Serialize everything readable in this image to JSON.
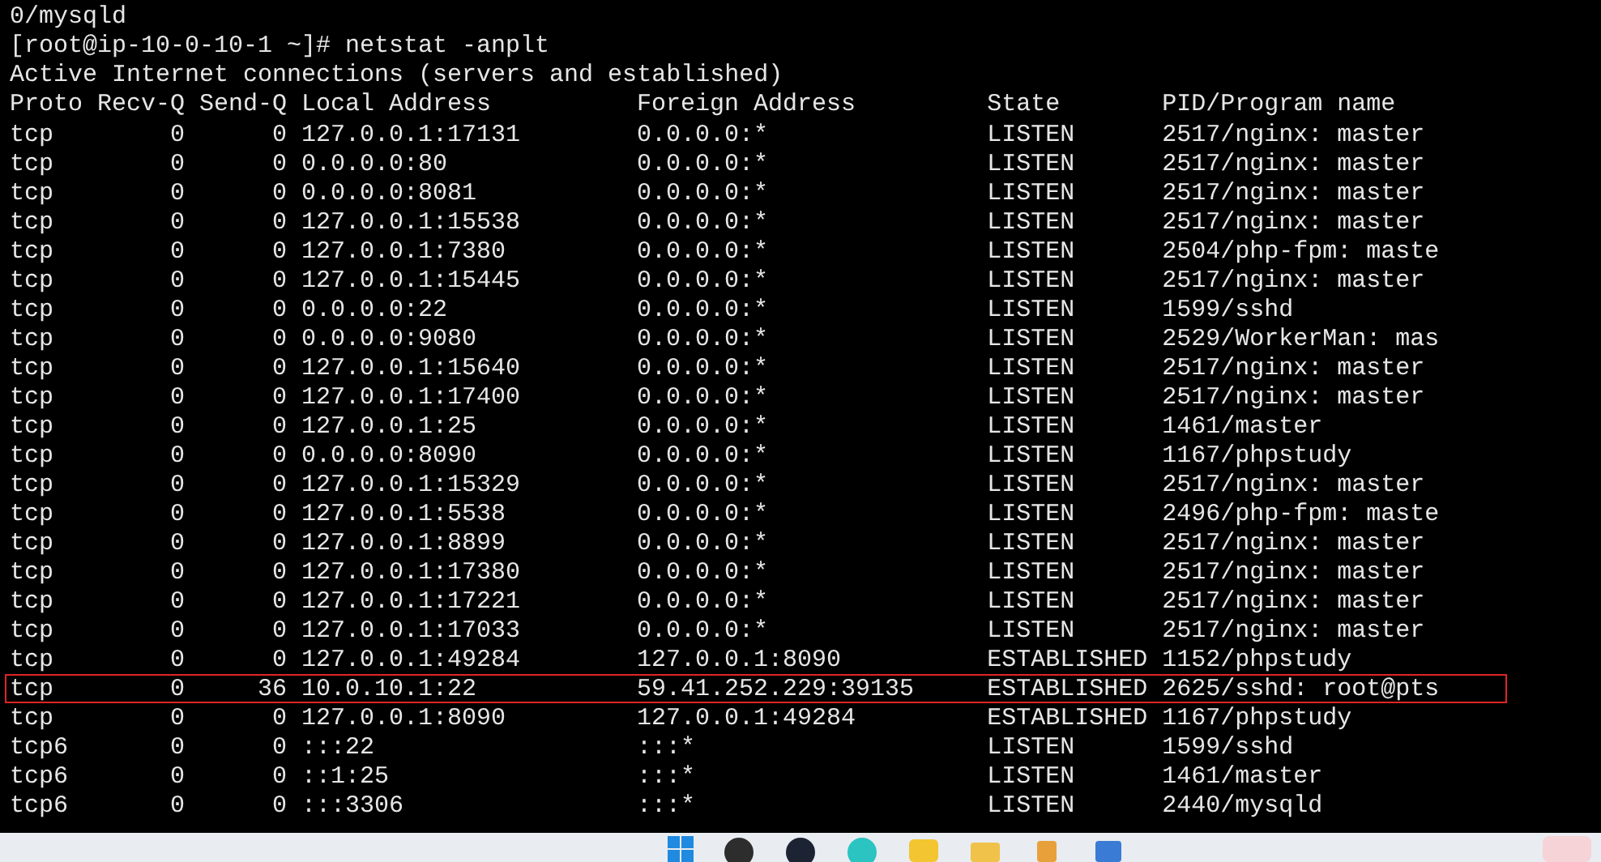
{
  "lines_above": [
    "0/mysqld",
    "[root@ip-10-0-10-1 ~]# netstat -anplt",
    "Active Internet connections (servers and established)"
  ],
  "table": {
    "columns": [
      "Proto",
      "Recv-Q",
      "Send-Q",
      "Local Address",
      "Foreign Address",
      "State",
      "PID/Program name"
    ],
    "rows": [
      {
        "proto": "tcp",
        "recv_q": "0",
        "send_q": "0",
        "local": "127.0.0.1:17131",
        "foreign": "0.0.0.0:*",
        "state": "LISTEN",
        "program": "2517/nginx: master",
        "highlighted": false
      },
      {
        "proto": "tcp",
        "recv_q": "0",
        "send_q": "0",
        "local": "0.0.0.0:80",
        "foreign": "0.0.0.0:*",
        "state": "LISTEN",
        "program": "2517/nginx: master",
        "highlighted": false
      },
      {
        "proto": "tcp",
        "recv_q": "0",
        "send_q": "0",
        "local": "0.0.0.0:8081",
        "foreign": "0.0.0.0:*",
        "state": "LISTEN",
        "program": "2517/nginx: master",
        "highlighted": false
      },
      {
        "proto": "tcp",
        "recv_q": "0",
        "send_q": "0",
        "local": "127.0.0.1:15538",
        "foreign": "0.0.0.0:*",
        "state": "LISTEN",
        "program": "2517/nginx: master",
        "highlighted": false
      },
      {
        "proto": "tcp",
        "recv_q": "0",
        "send_q": "0",
        "local": "127.0.0.1:7380",
        "foreign": "0.0.0.0:*",
        "state": "LISTEN",
        "program": "2504/php-fpm: maste",
        "highlighted": false
      },
      {
        "proto": "tcp",
        "recv_q": "0",
        "send_q": "0",
        "local": "127.0.0.1:15445",
        "foreign": "0.0.0.0:*",
        "state": "LISTEN",
        "program": "2517/nginx: master",
        "highlighted": false
      },
      {
        "proto": "tcp",
        "recv_q": "0",
        "send_q": "0",
        "local": "0.0.0.0:22",
        "foreign": "0.0.0.0:*",
        "state": "LISTEN",
        "program": "1599/sshd",
        "highlighted": false
      },
      {
        "proto": "tcp",
        "recv_q": "0",
        "send_q": "0",
        "local": "0.0.0.0:9080",
        "foreign": "0.0.0.0:*",
        "state": "LISTEN",
        "program": "2529/WorkerMan: mas",
        "highlighted": false
      },
      {
        "proto": "tcp",
        "recv_q": "0",
        "send_q": "0",
        "local": "127.0.0.1:15640",
        "foreign": "0.0.0.0:*",
        "state": "LISTEN",
        "program": "2517/nginx: master",
        "highlighted": false
      },
      {
        "proto": "tcp",
        "recv_q": "0",
        "send_q": "0",
        "local": "127.0.0.1:17400",
        "foreign": "0.0.0.0:*",
        "state": "LISTEN",
        "program": "2517/nginx: master",
        "highlighted": false
      },
      {
        "proto": "tcp",
        "recv_q": "0",
        "send_q": "0",
        "local": "127.0.0.1:25",
        "foreign": "0.0.0.0:*",
        "state": "LISTEN",
        "program": "1461/master",
        "highlighted": false
      },
      {
        "proto": "tcp",
        "recv_q": "0",
        "send_q": "0",
        "local": "0.0.0.0:8090",
        "foreign": "0.0.0.0:*",
        "state": "LISTEN",
        "program": "1167/phpstudy",
        "highlighted": false
      },
      {
        "proto": "tcp",
        "recv_q": "0",
        "send_q": "0",
        "local": "127.0.0.1:15329",
        "foreign": "0.0.0.0:*",
        "state": "LISTEN",
        "program": "2517/nginx: master",
        "highlighted": false
      },
      {
        "proto": "tcp",
        "recv_q": "0",
        "send_q": "0",
        "local": "127.0.0.1:5538",
        "foreign": "0.0.0.0:*",
        "state": "LISTEN",
        "program": "2496/php-fpm: maste",
        "highlighted": false
      },
      {
        "proto": "tcp",
        "recv_q": "0",
        "send_q": "0",
        "local": "127.0.0.1:8899",
        "foreign": "0.0.0.0:*",
        "state": "LISTEN",
        "program": "2517/nginx: master",
        "highlighted": false
      },
      {
        "proto": "tcp",
        "recv_q": "0",
        "send_q": "0",
        "local": "127.0.0.1:17380",
        "foreign": "0.0.0.0:*",
        "state": "LISTEN",
        "program": "2517/nginx: master",
        "highlighted": false
      },
      {
        "proto": "tcp",
        "recv_q": "0",
        "send_q": "0",
        "local": "127.0.0.1:17221",
        "foreign": "0.0.0.0:*",
        "state": "LISTEN",
        "program": "2517/nginx: master",
        "highlighted": false
      },
      {
        "proto": "tcp",
        "recv_q": "0",
        "send_q": "0",
        "local": "127.0.0.1:17033",
        "foreign": "0.0.0.0:*",
        "state": "LISTEN",
        "program": "2517/nginx: master",
        "highlighted": false
      },
      {
        "proto": "tcp",
        "recv_q": "0",
        "send_q": "0",
        "local": "127.0.0.1:49284",
        "foreign": "127.0.0.1:8090",
        "state": "ESTABLISHED",
        "program": "1152/phpstudy",
        "highlighted": false
      },
      {
        "proto": "tcp",
        "recv_q": "0",
        "send_q": "36",
        "local": "10.0.10.1:22",
        "foreign": "59.41.252.229:39135",
        "state": "ESTABLISHED",
        "program": "2625/sshd: root@pts",
        "highlighted": true
      },
      {
        "proto": "tcp",
        "recv_q": "0",
        "send_q": "0",
        "local": "127.0.0.1:8090",
        "foreign": "127.0.0.1:49284",
        "state": "ESTABLISHED",
        "program": "1167/phpstudy",
        "highlighted": false
      },
      {
        "proto": "tcp6",
        "recv_q": "0",
        "send_q": "0",
        "local": ":::22",
        "foreign": ":::*",
        "state": "LISTEN",
        "program": "1599/sshd",
        "highlighted": false
      },
      {
        "proto": "tcp6",
        "recv_q": "0",
        "send_q": "0",
        "local": "::1:25",
        "foreign": ":::*",
        "state": "LISTEN",
        "program": "1461/master",
        "highlighted": false
      },
      {
        "proto": "tcp6",
        "recv_q": "0",
        "send_q": "0",
        "local": ":::3306",
        "foreign": ":::*",
        "state": "LISTEN",
        "program": "2440/mysqld",
        "highlighted": false
      }
    ]
  }
}
